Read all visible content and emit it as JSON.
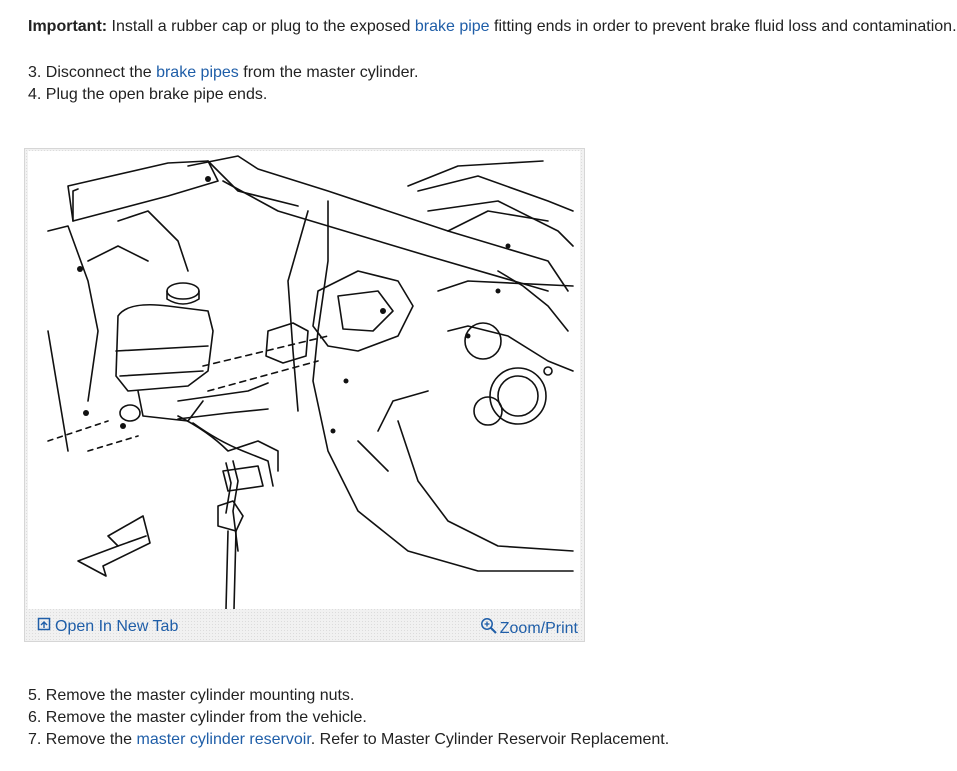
{
  "important": {
    "label": "Important:",
    "text_before": " Install a rubber cap or plug to the exposed ",
    "link": "brake pipe",
    "text_after": " fitting ends in order to prevent brake fluid loss and contamination."
  },
  "steps_top": {
    "step3_before": "3. Disconnect the ",
    "step3_link": "brake pipes",
    "step3_after": " from the master cylinder.",
    "step4": "4. Plug the open brake pipe ends."
  },
  "figure": {
    "open_tab_label": "Open In New Tab",
    "zoom_label": "Zoom/Print",
    "open_tab_icon": "open-tab-icon",
    "zoom_icon": "magnifier-plus-icon"
  },
  "steps_bottom": {
    "step5": "5. Remove the master cylinder mounting nuts.",
    "step6": "6. Remove the master cylinder from the vehicle.",
    "step7_before": "7. Remove the ",
    "step7_link": "master cylinder reservoir",
    "step7_after": ". Refer to Master Cylinder Reservoir Replacement."
  },
  "colors": {
    "link": "#1f5ea8",
    "text": "#222222",
    "figure_border": "#d6d6d6"
  }
}
